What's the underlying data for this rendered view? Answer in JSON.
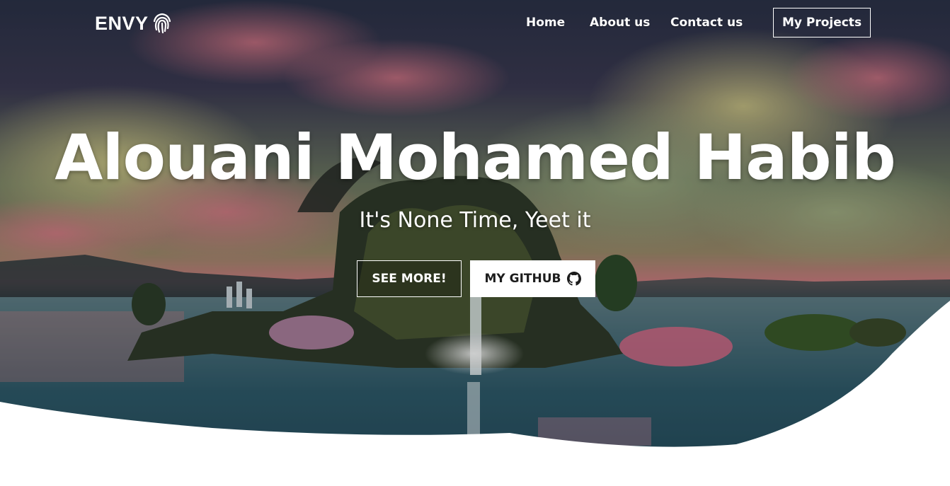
{
  "brand": {
    "name": "ENVY",
    "icon": "fingerprint-icon"
  },
  "nav": {
    "links": [
      "Home",
      "About us",
      "Contact us"
    ],
    "cta": "My Projects"
  },
  "hero": {
    "title": "Alouani Mohamed Habib",
    "subtitle": "It's None Time, Yeet it",
    "primary_button": "SEE MORE!",
    "secondary_button": "MY GITHUB",
    "secondary_icon": "github-icon"
  },
  "colors": {
    "text": "#ffffff",
    "button_solid_bg": "#ffffff",
    "button_solid_text": "#1c1c1c",
    "page_bg": "#ffffff"
  }
}
